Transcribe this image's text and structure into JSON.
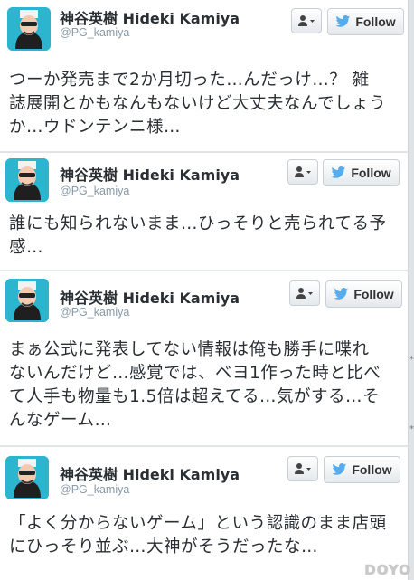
{
  "colors": {
    "avatar_bg": "#2bb5cf",
    "twitter_blue": "#55acee",
    "text": "#292f33",
    "handle": "#8899a6"
  },
  "icons": {
    "user_menu": "user-dropdown-icon",
    "follow": "twitter-bird-icon"
  },
  "tweets": [
    {
      "name": "神谷英樹 Hideki Kamiya",
      "handle": "@PG_kamiya",
      "follow_label": "Follow",
      "text": "つーか発売まで2か月切った…んだっけ…？ 雑\n誌展開とかもなんもないけど大丈夫なんでしょう\nか…ウドンテンニ様…"
    },
    {
      "name": "神谷英樹 Hideki Kamiya",
      "handle": "@PG_kamiya",
      "follow_label": "Follow",
      "text": "誰にも知られないまま…ひっそりと売られてる予\n感…"
    },
    {
      "name": "神谷英樹 Hideki Kamiya",
      "handle": "@PG_kamiya",
      "follow_label": "Follow",
      "text": "まぁ公式に発表してない情報は俺も勝手に喋れ\nないんだけど…感覚では、ベヨ1作った時と比べ\nて人手も物量も1.5倍は超えてる…気がする…そ\nんなゲーム…"
    },
    {
      "name": "神谷英樹 Hideki Kamiya",
      "handle": "@PG_kamiya",
      "follow_label": "Follow",
      "text": "「よく分からないゲーム」という認識のまま店頭\nにひっそり並ぶ…大神がそうだったな…"
    }
  ],
  "side_mark": "*",
  "watermark": "DOYO"
}
